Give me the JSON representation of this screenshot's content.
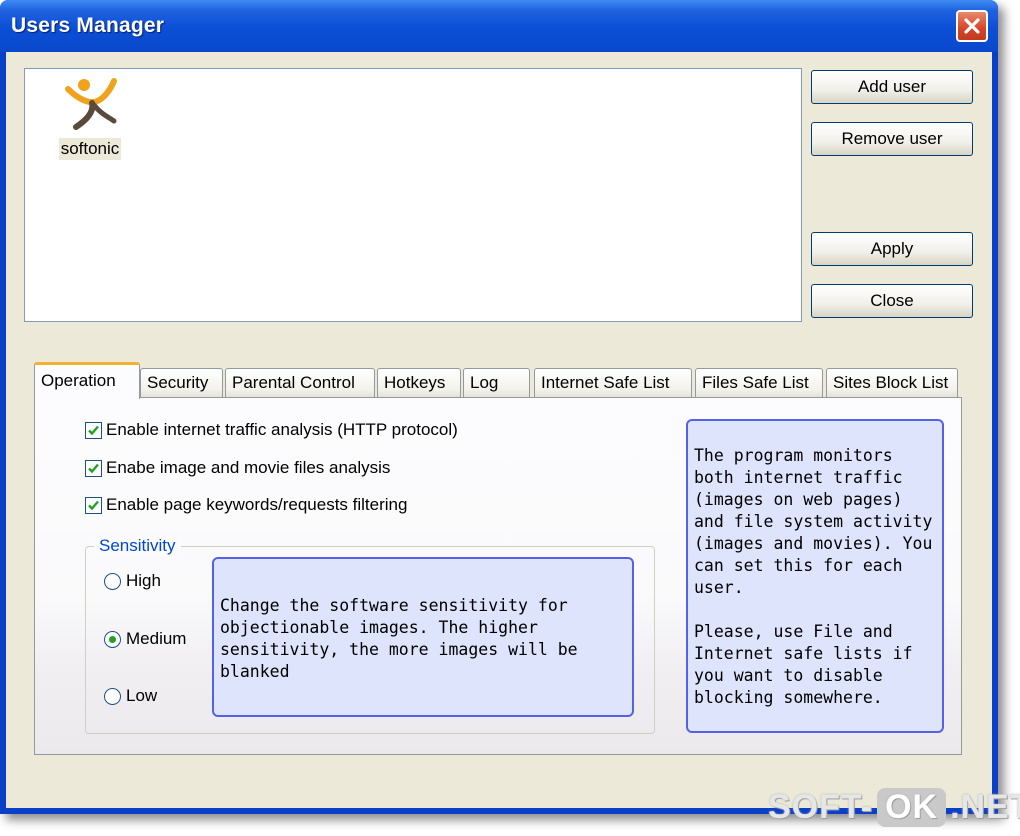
{
  "window": {
    "title": "Users Manager"
  },
  "users": [
    {
      "name": "softonic"
    }
  ],
  "buttons": {
    "add_user": "Add user",
    "remove_user": "Remove user",
    "apply": "Apply",
    "close": "Close"
  },
  "tabs": [
    {
      "label": "Operation",
      "active": true
    },
    {
      "label": "Security"
    },
    {
      "label": "Parental Control"
    },
    {
      "label": "Hotkeys"
    },
    {
      "label": "Log"
    },
    {
      "label": "Internet Safe List"
    },
    {
      "label": "Files Safe List"
    },
    {
      "label": "Sites Block List"
    }
  ],
  "operation": {
    "options": [
      {
        "label": "Enable internet traffic analysis (HTTP protocol)",
        "checked": true
      },
      {
        "label": "Enabe image and movie files analysis",
        "checked": true
      },
      {
        "label": "Enable page keywords/requests filtering",
        "checked": true
      }
    ],
    "sensitivity": {
      "title": "Sensitivity",
      "options": [
        {
          "label": "High",
          "selected": false
        },
        {
          "label": "Medium",
          "selected": true
        },
        {
          "label": "Low",
          "selected": false
        }
      ],
      "help": "Change the software sensitivity for objectionable images. The higher sensitivity, the more images will be blanked"
    },
    "info": "The program monitors both internet traffic (images on web pages) and file system activity (images and movies). You can set this for each user.\n\nPlease, use File and Internet safe lists if you want to disable blocking somewhere."
  },
  "watermark": {
    "left": "SOFT-",
    "middle": "OK",
    "right": ".NET"
  },
  "colors": {
    "titlebar": "#0a48cc",
    "client": "#ece9d8",
    "accent_tab": "#f2b131",
    "info_fill": "#dde4fb",
    "info_border": "#5562e8",
    "group_title": "#0046d5",
    "check_green": "#21a121",
    "close_button": "#d4442a"
  },
  "icons": {
    "window_close": "close-icon",
    "user": "softonic-user-icon",
    "check": "checkmark-icon"
  }
}
